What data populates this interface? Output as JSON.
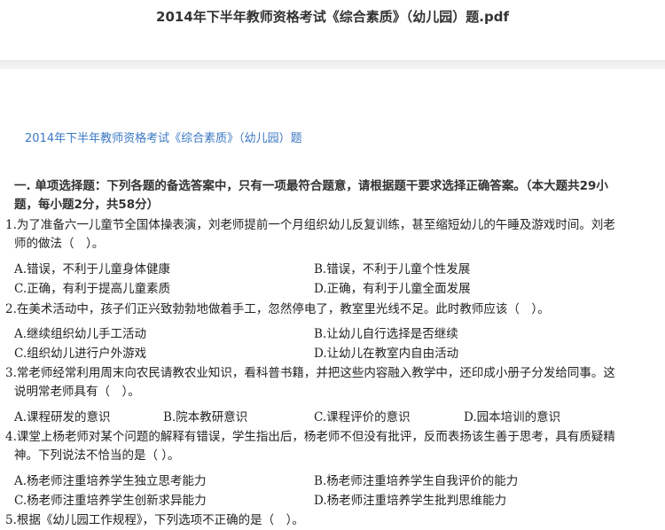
{
  "viewer": {
    "file_title": "2014年下半年教师资格考试《综合素质》（幼儿园）题.pdf"
  },
  "doc": {
    "header": "2014年下半年教师资格考试《综合素质》（幼儿园）题",
    "section": "一. 单项选择题：下列各题的备选答案中，只有一项最符合题意，请根据题干要求选择正确答案。（本大题共29小题，每小题2分，共58分）",
    "questions": [
      {
        "stem": "1.为了准备六一儿童节全国体操表演，刘老师提前一个月组织幼儿反复训练，甚至缩短幼儿的午睡及游戏时间。刘老师的做法（　）。",
        "options": [
          "A.错误，不利于儿童身体健康",
          "B.错误，不利于儿童个性发展",
          "C.正确，有利于提高儿童素质",
          "D.正确，有利于儿童全面发展"
        ]
      },
      {
        "stem": "2.在美术活动中，孩子们正兴致勃勃地做着手工，忽然停电了，教室里光线不足。此时教师应该（　）。",
        "options": [
          "A.继续组织幼儿手工活动",
          "B.让幼儿自行选择是否继续",
          "C.组织幼儿进行户外游戏",
          "D.让幼儿在教室内自由活动"
        ]
      },
      {
        "stem": "3.常老师经常利用周末向农民请教农业知识，看科普书籍，并把这些内容融入教学中，还印成小册子分发给同事。这说明常老师具有（　）。",
        "options": [
          "A.课程研发的意识",
          "B.院本教研意识",
          "C.课程评价的意识",
          "D.园本培训的意识"
        ]
      },
      {
        "stem": "4.课堂上杨老师对某个问题的解释有错误，学生指出后，杨老师不但没有批评，反而表扬该生善于思考，具有质疑精神。下列说法不恰当的是（ ）。",
        "options": [
          "A.杨老师注重培养学生独立思考能力",
          "B.杨老师注重培养学生自我评价的能力",
          "C.杨老师注重培养学生创新求异能力",
          "D.杨老师注重培养学生批判思维能力"
        ]
      },
      {
        "stem": "5.根据《幼儿园工作规程》，下列选项不正确的是（　）。",
        "options": []
      }
    ]
  }
}
